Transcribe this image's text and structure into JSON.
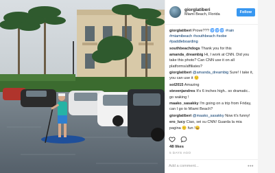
{
  "post": {
    "username": "giorglatiberi",
    "location": "Miami Beach, Florida",
    "follow_label": "Follow"
  },
  "comments": [
    {
      "user": "giorglatiberi",
      "text": "Prove??? 🌀🌀🌀 ",
      "links": "#rain #miamibeach #southbeach #sobe #paddleboarding"
    },
    {
      "user": "southbeachdogs",
      "text": "Thank you for this",
      "links": ""
    },
    {
      "user": "amanda_dreambig",
      "text": "Hi, I work at CNN. Did you take this photo? Can CNN use it on all platforms/affiliates?",
      "links": ""
    },
    {
      "user": "giorglatiberi",
      "text": "Sure! I take it, you can use it 🙂",
      "links": "@amanda_dreambig",
      "link_first": true
    },
    {
      "user": "sol2015",
      "text": "Amazing",
      "links": ""
    },
    {
      "user": "stevenjandres",
      "text": "It's 6 inches high.. so dramatic.. go waking !",
      "links": ""
    },
    {
      "user": "maako_sasakky",
      "text": "I'm going on a trip from Friday, can I go to Miami Beach?",
      "links": ""
    },
    {
      "user": "giorglatiberi",
      "text": "Now it's funny!",
      "links": "@maako_sasakky",
      "link_first": true
    },
    {
      "user": "ero_lucy",
      "text": "Ciao, sei su CNN! Guarda la mia pagina 🙂 fun !😀",
      "links": ""
    }
  ],
  "actions": {
    "like_icon": "heart-icon",
    "comment_icon": "speech-bubble-icon"
  },
  "likes": "48 likes",
  "date": "5 DAYS AGO",
  "add_comment_placeholder": "Add a comment..."
}
